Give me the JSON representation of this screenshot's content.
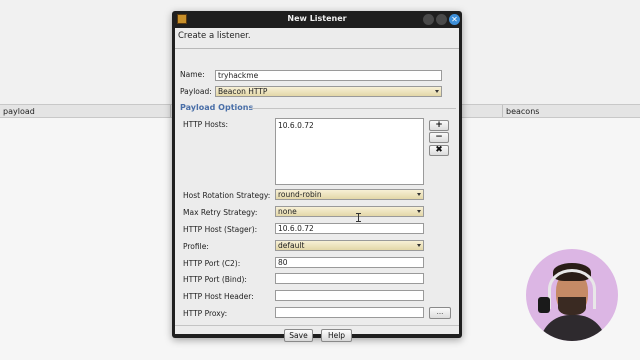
{
  "background": {
    "columns": [
      "payload",
      "beacons"
    ]
  },
  "dialog": {
    "title": "New Listener",
    "description": "Create a listener.",
    "name_label": "Name:",
    "name_value": "tryhackme",
    "payload_label": "Payload:",
    "payload_value": "Beacon HTTP",
    "group_title": "Payload Options",
    "http_hosts_label": "HTTP Hosts:",
    "http_hosts_value": "10.6.0.72",
    "add_symbol": "+",
    "remove_symbol": "−",
    "clear_symbol": "✖",
    "rotation_label": "Host Rotation Strategy:",
    "rotation_value": "round-robin",
    "retry_label": "Max Retry Strategy:",
    "retry_value": "none",
    "stager_label": "HTTP Host (Stager):",
    "stager_value": "10.6.0.72",
    "profile_label": "Profile:",
    "profile_value": "default",
    "port_c2_label": "HTTP Port (C2):",
    "port_c2_value": "80",
    "port_bind_label": "HTTP Port (Bind):",
    "port_bind_value": "",
    "host_header_label": "HTTP Host Header:",
    "host_header_value": "",
    "proxy_label": "HTTP Proxy:",
    "proxy_value": "",
    "proxy_button": "...",
    "save_label": "Save",
    "help_label": "Help"
  },
  "colors": {
    "titlebar": "#1f1f1f",
    "group_title": "#4a6fa8",
    "combo": "#e8dcb0",
    "close_button": "#3d8fd9"
  }
}
